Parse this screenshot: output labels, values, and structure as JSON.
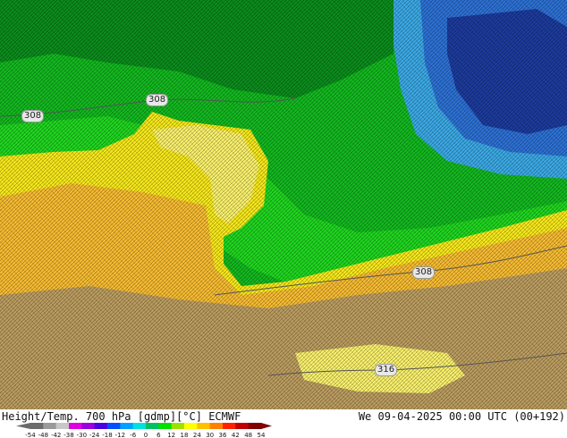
{
  "map": {
    "contour_labels": [
      {
        "id": "label-308-a",
        "text": "308"
      },
      {
        "id": "label-308-b",
        "text": "308"
      },
      {
        "id": "label-308-c",
        "text": "308"
      },
      {
        "id": "label-316",
        "text": "316"
      }
    ],
    "colors": {
      "dark_green": "#0b8a1c",
      "green": "#13b51f",
      "bright_green": "#1fd21f",
      "yellow": "#f2e41a",
      "pale_yellow": "#f4ec6a",
      "orange": "#f2b830",
      "brown": "#b89a5e",
      "light_blue": "#3aa6e0",
      "blue": "#2c6fd1",
      "navy": "#1c3a9a"
    }
  },
  "footer": {
    "title": "Height/Temp. 700 hPa [gdmp][°C] ECMWF",
    "datetime": "We 09-04-2025 00:00 UTC (00+192)"
  },
  "colorbar": {
    "tick_labels": [
      "-54",
      "-48",
      "-42",
      "-38",
      "-30",
      "-24",
      "-18",
      "-12",
      "-6",
      "0",
      "6",
      "12",
      "18",
      "24",
      "30",
      "36",
      "42",
      "48",
      "54"
    ],
    "colors": [
      "#6b6b6b",
      "#9a9a9a",
      "#c7c7c7",
      "#e000e0",
      "#9a00e0",
      "#4a00e0",
      "#0050ff",
      "#00a0ff",
      "#00e0e0",
      "#00c060",
      "#00e000",
      "#a0e000",
      "#ffff00",
      "#ffc000",
      "#ff8000",
      "#ff2000",
      "#c00000",
      "#800000"
    ]
  }
}
